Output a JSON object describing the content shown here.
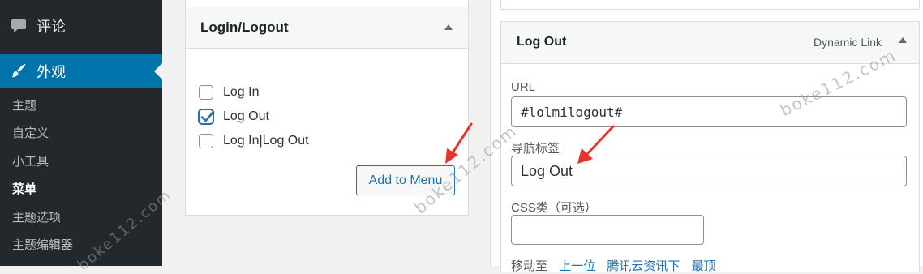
{
  "sidebar": {
    "comments": {
      "label": "评论",
      "icon": "comment-icon"
    },
    "appearance": {
      "label": "外观",
      "icon": "paintbrush-icon"
    },
    "submenu": [
      {
        "label": "主题"
      },
      {
        "label": "自定义"
      },
      {
        "label": "小工具"
      },
      {
        "label": "菜单",
        "current": true
      },
      {
        "label": "主题选项"
      },
      {
        "label": "主题编辑器"
      }
    ]
  },
  "login_logout_panel": {
    "title": "Login/Logout",
    "options": [
      {
        "label": "Log In",
        "checked": false
      },
      {
        "label": "Log Out",
        "checked": true
      },
      {
        "label": "Log In|Log Out",
        "checked": false
      }
    ],
    "add_button": "Add to Menu"
  },
  "menu_item": {
    "title": "Log Out",
    "type": "Dynamic Link",
    "url_label": "URL",
    "url_value": "#lolmilogout#",
    "nav_label": "导航标签",
    "nav_value": "Log Out",
    "css_label": "CSS类（可选）",
    "css_value": "",
    "move_label": "移动至",
    "move_links": [
      "上一位",
      "腾讯云资讯下",
      "最顶"
    ]
  },
  "watermarks": [
    "boke112.com",
    "boke112.com",
    "boke112.com"
  ],
  "colors": {
    "sidebar_bg": "#23282d",
    "active_menu": "#0073aa",
    "link_blue": "#2271b1",
    "annotation_arrow": "#e8332a"
  }
}
